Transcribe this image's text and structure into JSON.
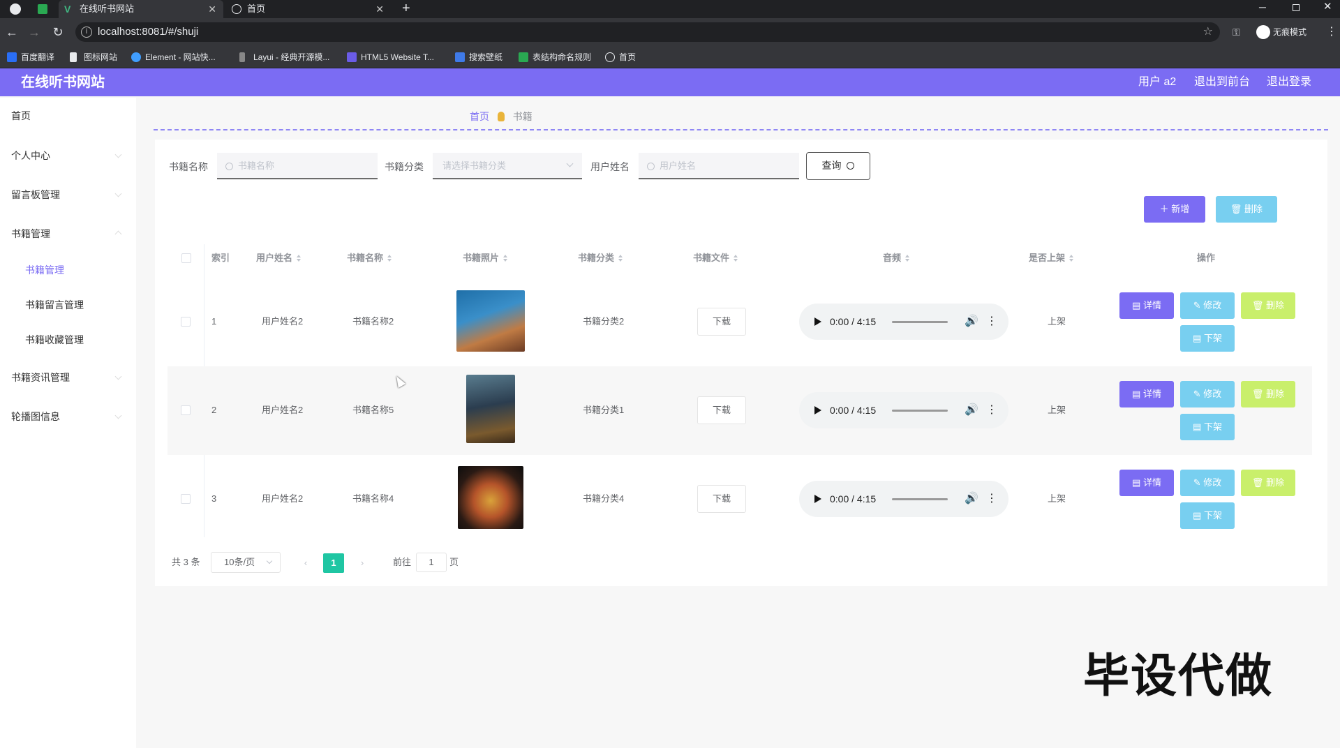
{
  "browser": {
    "tabs": [
      {
        "title": "在线听书网站"
      },
      {
        "title": "首页"
      }
    ],
    "url": "localhost:8081/#/shuji",
    "incognito_label": "无痕模式",
    "bookmarks": [
      "百度翻译",
      "图标网站",
      "Element - 网站快...",
      "Layui - 经典开源模...",
      "HTML5 Website T...",
      "搜索壁纸",
      "表结构命名规则",
      "首页"
    ]
  },
  "header": {
    "brand": "在线听书网站",
    "user": "用户 a2",
    "to_front": "退出到前台",
    "logout": "退出登录"
  },
  "sidebar": {
    "items": [
      "首页",
      "个人中心",
      "留言板管理",
      "书籍管理",
      "书籍管理",
      "书籍留言管理",
      "书籍收藏管理",
      "书籍资讯管理",
      "轮播图信息"
    ]
  },
  "breadcrumb": {
    "home": "首页",
    "current": "书籍"
  },
  "filters": {
    "book_name_label": "书籍名称",
    "book_name_placeholder": "书籍名称",
    "category_label": "书籍分类",
    "category_placeholder": "请选择书籍分类",
    "username_label": "用户姓名",
    "username_placeholder": "用户姓名",
    "query_label": "查询"
  },
  "toolbar": {
    "add_label": "新增",
    "delete_label": "删除"
  },
  "table": {
    "headers": [
      "索引",
      "用户姓名",
      "书籍名称",
      "书籍照片",
      "书籍分类",
      "书籍文件",
      "音频",
      "是否上架",
      "操作"
    ],
    "rows": [
      {
        "index": "1",
        "user": "用户姓名2",
        "book": "书籍名称2",
        "category": "书籍分类2",
        "file": "下载",
        "audio_time": "0:00 / 4:15",
        "status": "上架"
      },
      {
        "index": "2",
        "user": "用户姓名2",
        "book": "书籍名称5",
        "category": "书籍分类1",
        "file": "下载",
        "audio_time": "0:00 / 4:15",
        "status": "上架"
      },
      {
        "index": "3",
        "user": "用户姓名2",
        "book": "书籍名称4",
        "category": "书籍分类4",
        "file": "下载",
        "audio_time": "0:00 / 4:15",
        "status": "上架"
      }
    ],
    "actions": {
      "detail": "详情",
      "edit": "修改",
      "delete": "删除",
      "off_shelf": "下架"
    }
  },
  "pagination": {
    "total": "共 3 条",
    "page_size": "10条/页",
    "current_page": "1",
    "goto_label": "前往",
    "goto_value": "1",
    "page_suffix": "页"
  },
  "watermark": "毕设代做",
  "colors": {
    "primary": "#7b6cf3",
    "info": "#78cff0",
    "danger_light": "#c9ef6b",
    "pager_active": "#1fc6a3"
  }
}
